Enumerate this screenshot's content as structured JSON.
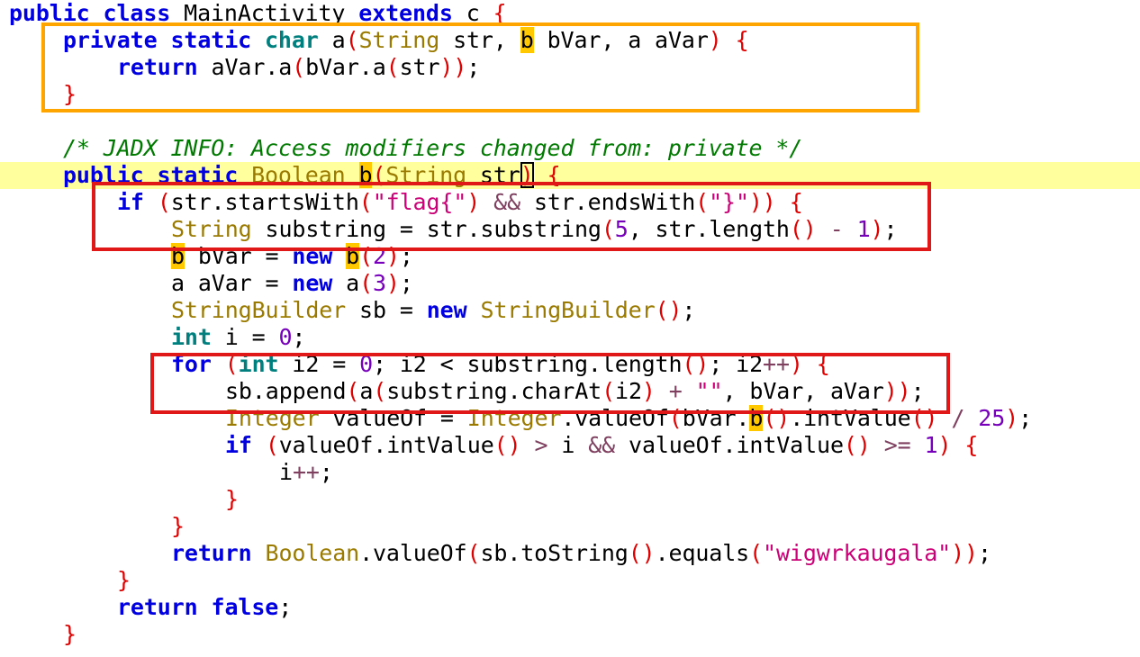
{
  "code": {
    "class_decl": {
      "kw1": "public",
      "kw2": "class",
      "name": "MainActivity",
      "kw3": "extends",
      "parent": "c",
      "brace": "{"
    },
    "method_a": {
      "sig": {
        "kw1": "private",
        "kw2": "static",
        "ret": "char",
        "name": "a",
        "p_open": "(",
        "t1": "String",
        "n1": " str, ",
        "t2": "b",
        "n2": " bVar, a aVar",
        "p_close": ")",
        "brace": "{"
      },
      "body": {
        "kw": "return",
        "t1": "aVar.a",
        "p1": "(",
        "t2": "bVar.a",
        "p2": "(",
        "t3": "str",
        "p3": "))",
        "semi": ";"
      },
      "close": "}"
    },
    "comment": "/* JADX INFO: Access modifiers changed from: private */",
    "method_b": {
      "sig": {
        "kw1": "public",
        "kw2": "static",
        "ret": "Boolean",
        "name": "b",
        "p_open": "(",
        "t1": "String",
        "n1": " str",
        "p_close": ")",
        "brace": "{"
      },
      "if_line": {
        "kw": "if",
        "p1": "(",
        "t1": "str.startsWith",
        "p2": "(",
        "s1": "\"flag{\"",
        "p3": ")",
        "op": "&&",
        "t2": "str.endsWith",
        "p4": "(",
        "s2": "\"}\"",
        "p5": "))",
        "brace": "{"
      },
      "substring_line": {
        "t1": "String",
        "t2": " substring = str.substring",
        "p1": "(",
        "n1": "5",
        "t3": ", str.length",
        "p2": "()",
        "op": "-",
        "n2": "1",
        "p3": ")",
        "semi": ";"
      },
      "bvar_line": {
        "t1": "b",
        "t2": " bVar = ",
        "kw": "new",
        "t3": "b",
        "p1": "(",
        "n1": "2",
        "p2": ")",
        "semi": ";"
      },
      "avar_line": {
        "t1": "a aVar = ",
        "kw": "new",
        "t2": " a",
        "p1": "(",
        "n1": "3",
        "p2": ")",
        "semi": ";"
      },
      "sb_line": {
        "t1": "StringBuilder",
        "t2": " sb = ",
        "kw": "new",
        "t3": "StringBuilder",
        "p1": "()",
        "semi": ";"
      },
      "int_line": {
        "kw": "int",
        "t1": " i = ",
        "n1": "0",
        "semi": ";"
      },
      "for_line": {
        "kw": "for",
        "p1": "(",
        "kw2": "int",
        "t1": " i2 = ",
        "n1": "0",
        "t2": "; i2 < substring.length",
        "p2": "()",
        "t3": "; i2",
        "op": "++",
        "p3": ")",
        "brace": "{"
      },
      "append_line": {
        "t1": "sb.append",
        "p1": "(",
        "t2": "a",
        "p2": "(",
        "t3": "substring.charAt",
        "p3": "(",
        "t4": "i2",
        "p4": ")",
        "op": "+",
        "s1": "\"\"",
        "t5": ", bVar, aVar",
        "p5": "))",
        "semi": ";"
      },
      "valueof_line": {
        "t1": "Integer",
        "t2": " valueOf = ",
        "t3": "Integer",
        "t4": ".valueOf",
        "p1": "(",
        "t5": "bVar.",
        "t6": "b",
        "p2": "()",
        "t7": ".intValue",
        "p3": "()",
        "op": "/",
        "n1": "25",
        "p4": ")",
        "semi": ";"
      },
      "if2_line": {
        "kw": "if",
        "p1": "(",
        "t1": "valueOf.intValue",
        "p2": "()",
        "op1": ">",
        "t2": " i ",
        "op2": "&&",
        "t3": " valueOf.intValue",
        "p3": "()",
        "op3": ">=",
        "n1": "1",
        "p4": ")",
        "brace": "{"
      },
      "inc_line": {
        "t1": "i",
        "op": "++",
        "semi": ";"
      },
      "close_if2": "}",
      "close_for": "}",
      "return_line": {
        "kw": "return",
        "t1": "Boolean",
        "t2": ".valueOf",
        "p1": "(",
        "t3": "sb.toString",
        "p2": "()",
        "t4": ".equals",
        "p3": "(",
        "s1": "\"wigwrkaugala\"",
        "p4": "))",
        "semi": ";"
      },
      "close_if": "}",
      "return_false": {
        "kw1": "return",
        "kw2": "false",
        "semi": ";"
      },
      "close": "}"
    }
  },
  "colors": {
    "keyword": "#0000e0",
    "type_keyword": "#007f7f",
    "class_name": "#9a7a00",
    "bracket": "#e00000",
    "number": "#7700bb",
    "string": "#cc0077",
    "comment": "#007a00",
    "current_line_highlight": "#ffff9e",
    "usage_highlight": "#ffc800",
    "box_orange": "#ffa500",
    "box_red": "#e01818"
  }
}
